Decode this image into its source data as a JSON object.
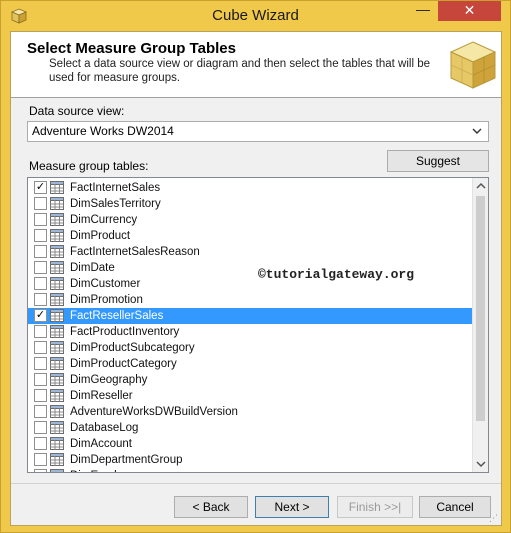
{
  "window": {
    "title": "Cube Wizard",
    "minimize_glyph": "—",
    "close_glyph": "✕"
  },
  "header": {
    "title": "Select Measure Group Tables",
    "description": "Select a data source view or diagram and then select the tables that will be used for measure groups."
  },
  "dsv": {
    "label": "Data source view:",
    "selected": "Adventure Works DW2014"
  },
  "measure_tables": {
    "label": "Measure group tables:",
    "suggest_label": "Suggest",
    "items": [
      {
        "label": "FactInternetSales",
        "checked": true,
        "selected": false
      },
      {
        "label": "DimSalesTerritory",
        "checked": false,
        "selected": false
      },
      {
        "label": "DimCurrency",
        "checked": false,
        "selected": false
      },
      {
        "label": "DimProduct",
        "checked": false,
        "selected": false
      },
      {
        "label": "FactInternetSalesReason",
        "checked": false,
        "selected": false
      },
      {
        "label": "DimDate",
        "checked": false,
        "selected": false
      },
      {
        "label": "DimCustomer",
        "checked": false,
        "selected": false
      },
      {
        "label": "DimPromotion",
        "checked": false,
        "selected": false
      },
      {
        "label": "FactResellerSales",
        "checked": true,
        "selected": true
      },
      {
        "label": "FactProductInventory",
        "checked": false,
        "selected": false
      },
      {
        "label": "DimProductSubcategory",
        "checked": false,
        "selected": false
      },
      {
        "label": "DimProductCategory",
        "checked": false,
        "selected": false
      },
      {
        "label": "DimGeography",
        "checked": false,
        "selected": false
      },
      {
        "label": "DimReseller",
        "checked": false,
        "selected": false
      },
      {
        "label": "AdventureWorksDWBuildVersion",
        "checked": false,
        "selected": false
      },
      {
        "label": "DatabaseLog",
        "checked": false,
        "selected": false
      },
      {
        "label": "DimAccount",
        "checked": false,
        "selected": false
      },
      {
        "label": "DimDepartmentGroup",
        "checked": false,
        "selected": false
      },
      {
        "label": "DimEmployee",
        "checked": false,
        "selected": false
      }
    ]
  },
  "watermark": "©tutorialgateway.org",
  "footer": {
    "back_label": "< Back",
    "next_label": "Next >",
    "finish_label": "Finish >>|",
    "cancel_label": "Cancel"
  },
  "icons": {
    "app": "cube-wizard-icon",
    "table": "table-icon",
    "scroll_up": "scroll-up-icon",
    "scroll_down": "scroll-down-icon"
  },
  "colors": {
    "title_bar": "#f0c84a",
    "close_button": "#c7463c",
    "selection": "#3399ff"
  }
}
